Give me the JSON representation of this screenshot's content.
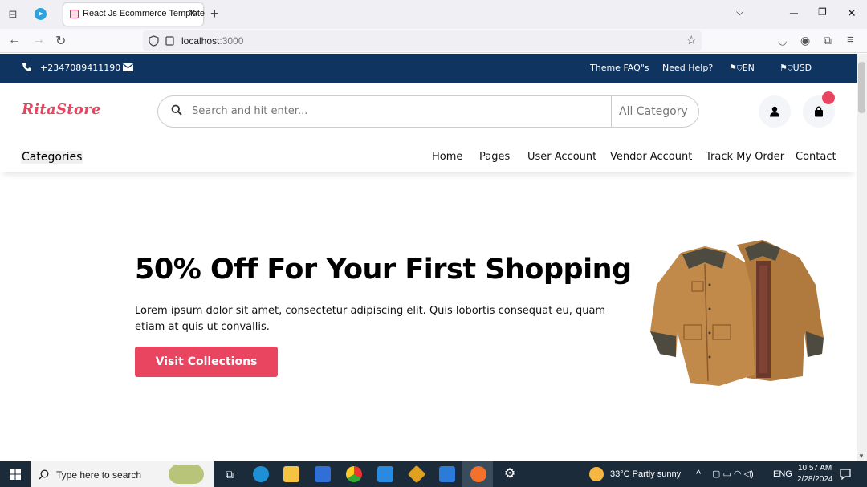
{
  "browser": {
    "tab_title": "React Js Ecommerce Template",
    "url_host": "localhost",
    "url_port": ":3000"
  },
  "topbar": {
    "phone": "+2347089411190",
    "links": [
      "Theme FAQ\"s",
      "Need Help?"
    ],
    "language": "EN",
    "currency": "USD"
  },
  "header": {
    "logo": "RitaStore",
    "search_placeholder": "Search and hit enter...",
    "category_select": "All Category"
  },
  "menu": {
    "categories_label": "Categories",
    "items": [
      "Home",
      "Pages",
      "User Account",
      "Vendor Account",
      "Track My Order",
      "Contact"
    ]
  },
  "hero": {
    "title": "50% Off For Your First Shopping",
    "description": "Lorem ipsum dolor sit amet, consectetur adipiscing elit. Quis lobortis consequat eu, quam etiam at quis ut convallis.",
    "button": "Visit Collections"
  },
  "taskbar": {
    "search_placeholder": "Type here to search",
    "weather": "33°C  Partly sunny",
    "language": "ENG",
    "time": "10:57 AM",
    "date": "2/28/2024"
  },
  "colors": {
    "brand": "#e94560",
    "topbar": "#0f3460"
  }
}
